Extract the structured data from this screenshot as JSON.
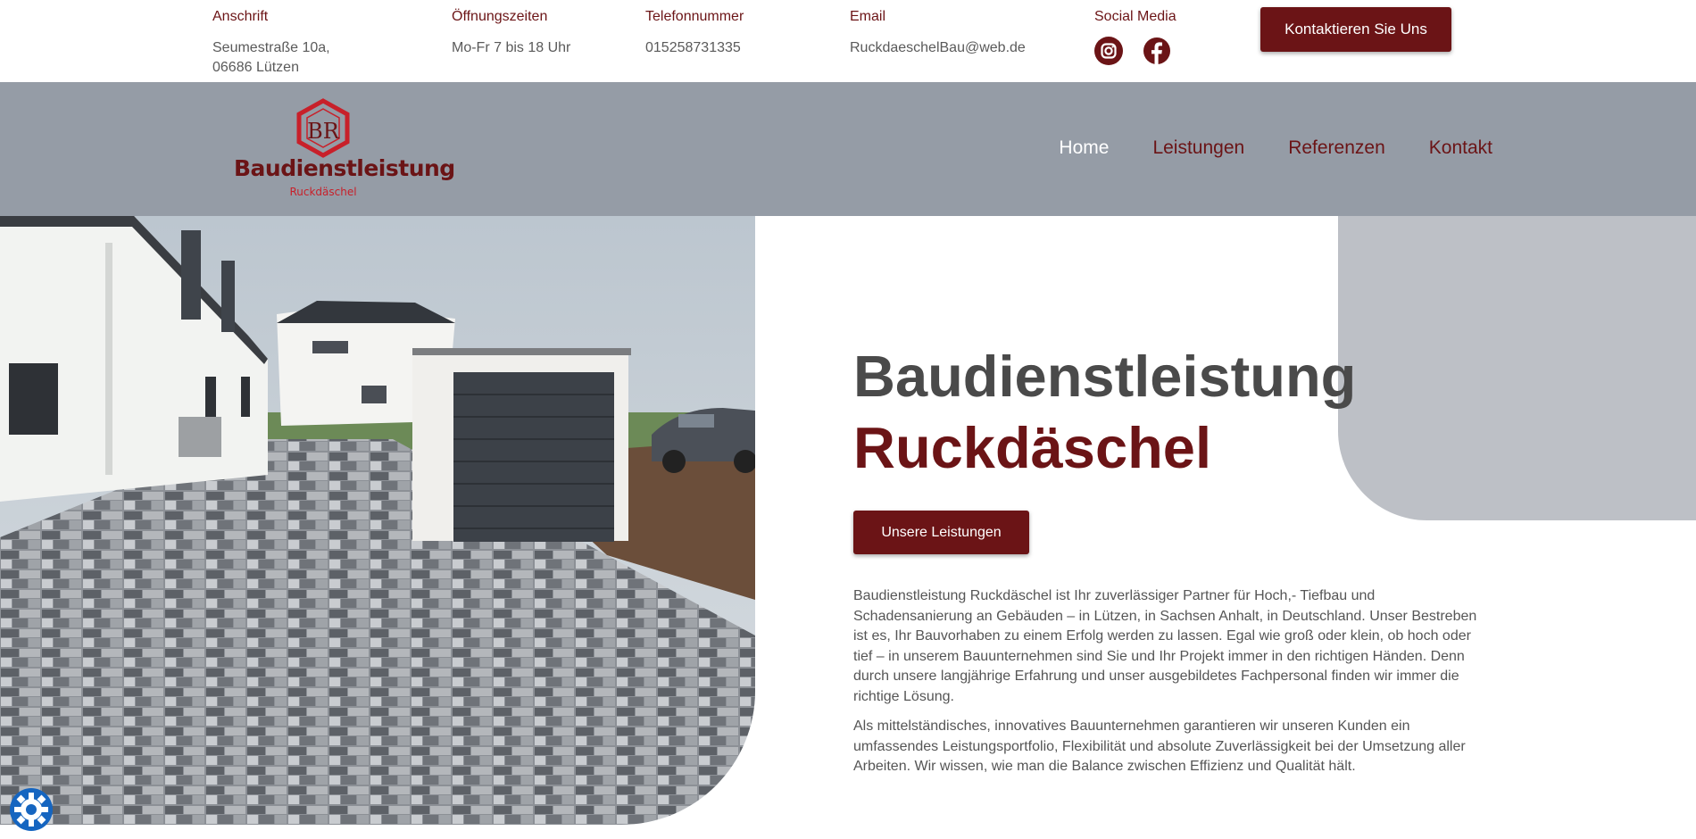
{
  "topbar": {
    "address": {
      "label": "Anschrift",
      "line1": "Seumestraße 10a,",
      "line2": "06686 Lützen"
    },
    "hours": {
      "label": "Öffnungszeiten",
      "value": "Mo-Fr 7 bis 18 Uhr"
    },
    "phone": {
      "label": "Telefonnummer",
      "value": "015258731335"
    },
    "email": {
      "label": "Email",
      "value": "RuckdaeschelBau@web.de"
    },
    "social": {
      "label": "Social Media",
      "icons": [
        "instagram-icon",
        "facebook-icon"
      ]
    },
    "contact_button": "Kontaktieren Sie Uns"
  },
  "logo": {
    "monogram": "BR",
    "name": "Baudienstleistung",
    "sub": "Ruckdäschel"
  },
  "nav": {
    "items": [
      "Home",
      "Leistungen",
      "Referenzen",
      "Kontakt"
    ],
    "active": "Home"
  },
  "hero": {
    "title_line1": "Baudienstleistung",
    "title_line2": "Ruckdäschel",
    "button": "Unsere Leistungen",
    "paragraph1": "Baudienstleistung Ruckdäschel ist Ihr zuverlässiger Partner für Hoch,- Tiefbau und Schadensanierung an Gebäuden – in Lützen, in Sachsen Anhalt, in Deutschland. Unser Bestreben ist es, Ihr Bauvorhaben zu einem Erfolg werden zu lassen. Egal wie groß oder klein, ob hoch oder tief – in unserem Bauunternehmen sind Sie und Ihr Projekt immer in den richtigen Händen. Denn durch unsere langjährige Erfahrung und unser ausgebildetes Fachpersonal finden wir immer die richtige Lösung.",
    "paragraph2": "Als mittelständisches, innovatives Bauunternehmen garantieren wir unseren Kunden ein umfassendes Leistungsportfolio, Flexibilität und absolute Zuverlässigkeit bei der Umsetzung aller Arbeiten. Wir wissen, wie man die Balance zwischen Effizienz und Qualität hält."
  },
  "colors": {
    "brand": "#6b1416",
    "nav_bg": "#959ca6",
    "accent_red": "#c8202a",
    "grey_shape": "#bdc0c6"
  }
}
